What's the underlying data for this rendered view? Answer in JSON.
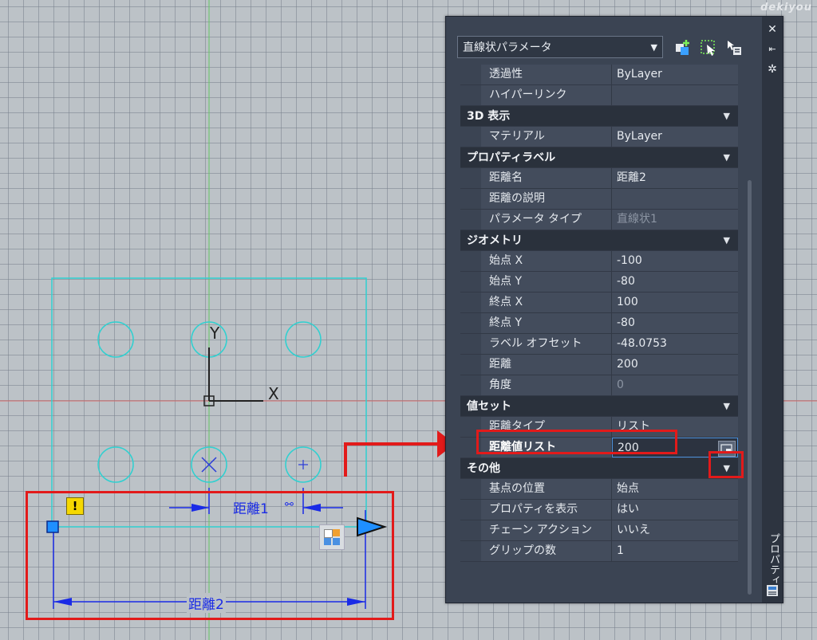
{
  "canvas": {
    "axis_y_label": "Y",
    "axis_x_label": "X",
    "dimension_1_label": "距離1",
    "dimension_2_label": "距離2",
    "warning_glyph": "!",
    "watermark": "dekiyou"
  },
  "palette": {
    "title": "プロパティ",
    "object_type": "直線状パラメータ",
    "categories": [
      {
        "name": "",
        "rows": [
          {
            "key": "透過性",
            "value": "ByLayer"
          },
          {
            "key": "ハイパーリンク",
            "value": ""
          }
        ]
      },
      {
        "name": "3D 表示",
        "rows": [
          {
            "key": "マテリアル",
            "value": "ByLayer"
          }
        ]
      },
      {
        "name": "プロパティラベル",
        "rows": [
          {
            "key": "距離名",
            "value": "距離2"
          },
          {
            "key": "距離の説明",
            "value": ""
          },
          {
            "key": "パラメータ タイプ",
            "value": "直線状1"
          }
        ]
      },
      {
        "name": "ジオメトリ",
        "rows": [
          {
            "key": "始点 X",
            "value": "-100"
          },
          {
            "key": "始点 Y",
            "value": "-80"
          },
          {
            "key": "終点 X",
            "value": "100"
          },
          {
            "key": "終点 Y",
            "value": "-80"
          },
          {
            "key": "ラベル オフセット",
            "value": "-48.0753"
          },
          {
            "key": "距離",
            "value": "200"
          },
          {
            "key": "角度",
            "value": "0"
          }
        ]
      },
      {
        "name": "値セット",
        "rows": [
          {
            "key": "距離タイプ",
            "value": "リスト"
          },
          {
            "key": "距離値リスト",
            "value": "200"
          }
        ]
      },
      {
        "name": "その他",
        "rows": [
          {
            "key": "基点の位置",
            "value": "始点"
          },
          {
            "key": "プロパティを表示",
            "value": "はい"
          },
          {
            "key": "チェーン アクション",
            "value": "いいえ"
          },
          {
            "key": "グリップの数",
            "value": "1"
          }
        ]
      }
    ]
  },
  "colors": {
    "annotation_red": "#e21a1a",
    "dimension_blue": "#1a2be6",
    "geometry_cyan": "#2fd0d0"
  }
}
